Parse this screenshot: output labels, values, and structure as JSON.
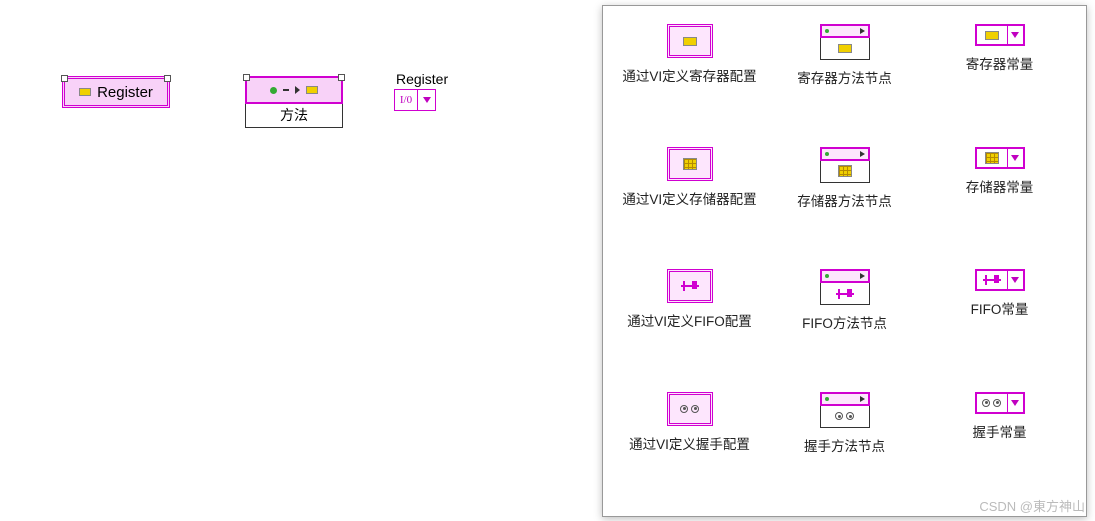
{
  "canvas": {
    "register_node_label": "Register",
    "method_node_label": "方法",
    "constant_node_label": "Register",
    "constant_glyph": "I/0"
  },
  "palette": {
    "row0": {
      "define": "通过VI定义寄存器配置",
      "method": "寄存器方法节点",
      "const": "寄存器常量"
    },
    "row1": {
      "define": "通过VI定义存储器配置",
      "method": "存储器方法节点",
      "const": "存储器常量"
    },
    "row2": {
      "define": "通过VI定义FIFO配置",
      "method": "FIFO方法节点",
      "const": "FIFO常量"
    },
    "row3": {
      "define": "通过VI定义握手配置",
      "method": "握手方法节点",
      "const": "握手常量"
    }
  },
  "watermark": "CSDN @東方神山"
}
